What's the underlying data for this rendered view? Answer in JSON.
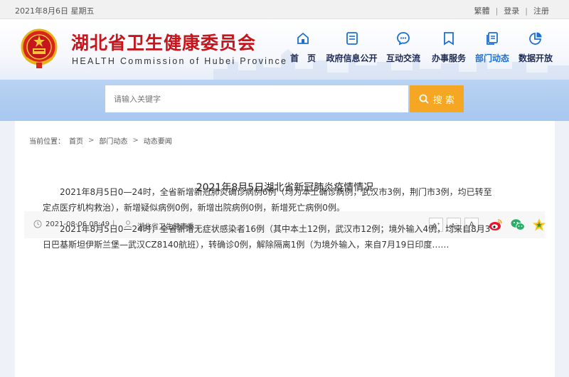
{
  "topbar": {
    "date": "2021年8月6日 星期五",
    "links": [
      "繁體",
      "登录",
      "注册"
    ],
    "separator": "|"
  },
  "header": {
    "title_cn": "湖北省卫生健康委员会",
    "title_en": "HEALTH Commission of Hubei Province",
    "nav": [
      {
        "label": "首　页",
        "icon": "home-icon"
      },
      {
        "label": "政府信息公开",
        "icon": "document-icon"
      },
      {
        "label": "互动交流",
        "icon": "chat-icon"
      },
      {
        "label": "办事服务",
        "icon": "bookmark-icon"
      },
      {
        "label": "部门动态",
        "icon": "files-icon",
        "active": true
      },
      {
        "label": "数据开放",
        "icon": "pie-chart-icon"
      }
    ]
  },
  "search": {
    "placeholder": "请输入关键字",
    "button": "搜 索"
  },
  "breadcrumb": {
    "prefix": "当前位置：",
    "items": [
      "首页",
      "部门动态",
      "动态要闻"
    ],
    "separator": ">"
  },
  "article": {
    "title": "2021年8月5日湖北省新冠肺炎疫情情况",
    "date": "2021-08-06 08:49",
    "divider": "|",
    "source": "湖北省卫生健康委",
    "font_buttons": [
      "A+",
      "A",
      "A"
    ],
    "share_icons": [
      "weibo-icon",
      "wechat-icon",
      "favorite-star-icon"
    ],
    "paragraphs": [
      "2021年8月5日0—24时，全省新增新冠肺炎确诊病例6例（均为本土确诊病例，武汉市3例，荆门市3例，均已转至定点医疗机构救治），新增疑似病例0例，新增出院病例0例，新增死亡病例0例。",
      "2021年8月5日0—24时，全省新增无症状感染者16例（其中本土12例，武汉市12例；境外输入4例，均来自8月3日巴基斯坦伊斯兰堡—武汉CZ8140航班），转确诊0例，解除隔离1例（为境外输入，来自7月19日印度……"
    ]
  },
  "colors": {
    "brand_red": "#c4161c",
    "nav_active": "#1c6fd3",
    "search_button": "#f5a623",
    "band": "#a6c7ef"
  }
}
